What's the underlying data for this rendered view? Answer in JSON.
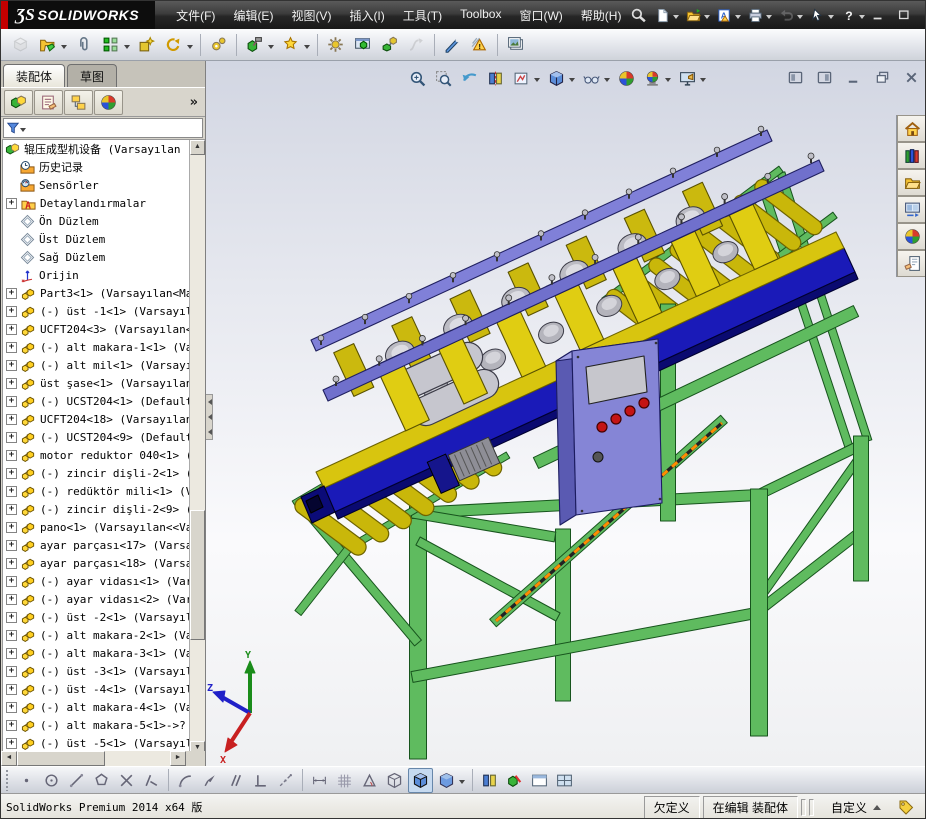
{
  "brand": {
    "mark": "ƷS",
    "name": "SOLIDWORKS"
  },
  "menu": {
    "items": [
      "文件(F)",
      "编辑(E)",
      "视图(V)",
      "插入(I)",
      "工具(T)",
      "Toolbox",
      "窗口(W)",
      "帮助(H)"
    ],
    "names": [
      "file",
      "edit",
      "view",
      "insert",
      "tools",
      "toolbox",
      "window",
      "help"
    ]
  },
  "left_panel": {
    "tabs": [
      {
        "label": "装配体",
        "active": true
      },
      {
        "label": "草图",
        "active": false
      }
    ],
    "overflow": "»"
  },
  "tree": {
    "items": [
      {
        "icon": "t-assembly",
        "plus": false,
        "indent": 0,
        "label": "辊压成型机设备 (Varsayılan"
      },
      {
        "icon": "t-history",
        "plus": false,
        "indent": 1,
        "label": "历史记录"
      },
      {
        "icon": "t-sensors",
        "plus": false,
        "indent": 1,
        "label": "Sensörler"
      },
      {
        "icon": "t-annotations",
        "plus": true,
        "indent": 1,
        "label": "Detaylandırmalar"
      },
      {
        "icon": "t-plane",
        "plus": false,
        "indent": 1,
        "label": "Ön Düzlem"
      },
      {
        "icon": "t-plane",
        "plus": false,
        "indent": 1,
        "label": "Üst Düzlem"
      },
      {
        "icon": "t-plane",
        "plus": false,
        "indent": 1,
        "label": "Sağ Düzlem"
      },
      {
        "icon": "t-origin",
        "plus": false,
        "indent": 1,
        "label": "Orijin"
      },
      {
        "icon": "t-part",
        "plus": true,
        "indent": 1,
        "label": "Part3<1> (Varsayılan<Mak"
      },
      {
        "icon": "t-part",
        "plus": true,
        "indent": 1,
        "label": "(-) üst -1<1> (Varsayıla"
      },
      {
        "icon": "t-part",
        "plus": true,
        "indent": 1,
        "label": "UCFT204<3> (Varsayılan<<"
      },
      {
        "icon": "t-part",
        "plus": true,
        "indent": 1,
        "label": "(-) alt makara-1<1> (Var"
      },
      {
        "icon": "t-part",
        "plus": true,
        "indent": 1,
        "label": "(-) alt mil<1> (Varsayıl"
      },
      {
        "icon": "t-part",
        "plus": true,
        "indent": 1,
        "label": "üst şase<1> (Varsayılan<"
      },
      {
        "icon": "t-part",
        "plus": true,
        "indent": 1,
        "label": "(-) UCST204<1> (Default<"
      },
      {
        "icon": "t-part",
        "plus": true,
        "indent": 1,
        "label": "UCFT204<18> (Varsayılan<"
      },
      {
        "icon": "t-part",
        "plus": true,
        "indent": 1,
        "label": "(-) UCST204<9> (Default<"
      },
      {
        "icon": "t-part",
        "plus": true,
        "indent": 1,
        "label": "motor reduktor 040<1> (V"
      },
      {
        "icon": "t-part",
        "plus": true,
        "indent": 1,
        "label": "(-) zincir dişli-2<1> (V"
      },
      {
        "icon": "t-part",
        "plus": true,
        "indent": 1,
        "label": "(-) redüktör mili<1> (V:"
      },
      {
        "icon": "t-part",
        "plus": true,
        "indent": 1,
        "label": "(-) zincir dişli-2<9> (V"
      },
      {
        "icon": "t-part",
        "plus": true,
        "indent": 1,
        "label": "pano<1> (Varsayılan<<Var"
      },
      {
        "icon": "t-part",
        "plus": true,
        "indent": 1,
        "label": "ayar parçası<17> (Varsay"
      },
      {
        "icon": "t-part",
        "plus": true,
        "indent": 1,
        "label": "ayar parçası<18> (Varsay"
      },
      {
        "icon": "t-part",
        "plus": true,
        "indent": 1,
        "label": "(-) ayar vidası<1> (Vars"
      },
      {
        "icon": "t-part",
        "plus": true,
        "indent": 1,
        "label": "(-) ayar vidası<2> (Vars"
      },
      {
        "icon": "t-part",
        "plus": true,
        "indent": 1,
        "label": "(-) üst -2<1> (Varsayıla"
      },
      {
        "icon": "t-part",
        "plus": true,
        "indent": 1,
        "label": "(-) alt makara-2<1> (Var"
      },
      {
        "icon": "t-part",
        "plus": true,
        "indent": 1,
        "label": "(-) alt makara-3<1> (Var"
      },
      {
        "icon": "t-part",
        "plus": true,
        "indent": 1,
        "label": "(-) üst -3<1> (Varsayıla"
      },
      {
        "icon": "t-part",
        "plus": true,
        "indent": 1,
        "label": "(-) üst -4<1> (Varsayıla"
      },
      {
        "icon": "t-part",
        "plus": true,
        "indent": 1,
        "label": "(-) alt makara-4<1> (Var"
      },
      {
        "icon": "t-part",
        "plus": true,
        "indent": 1,
        "label": "(-) alt makara-5<1>->?"
      },
      {
        "icon": "t-part",
        "plus": true,
        "indent": 1,
        "label": "(-) üst -5<1> (Varsayıla"
      },
      {
        "icon": "t-part",
        "plus": true,
        "indent": 1,
        "label": ""
      }
    ]
  },
  "toolbars": {
    "quick_access": [
      {
        "name": "new-document",
        "dropdown": true
      },
      {
        "name": "open-folder",
        "dropdown": true
      },
      {
        "name": "report",
        "dropdown": true
      },
      {
        "name": "print",
        "dropdown": true
      },
      {
        "name": "undo",
        "dropdown": true,
        "disabled": true
      },
      {
        "name": "select-cursor",
        "dropdown": true
      },
      {
        "name": "help",
        "dropdown": true
      }
    ],
    "assembly": [
      {
        "name": "insert-components",
        "disabled": true
      },
      {
        "name": "edit-component",
        "dropdown": true
      },
      {
        "name": "mate"
      },
      {
        "name": "component-pattern",
        "dropdown": true
      },
      {
        "name": "smart-fasteners"
      },
      {
        "name": "move-component",
        "dropdown": true
      },
      {
        "sep": true
      },
      {
        "name": "gear-tools"
      },
      {
        "sep": true
      },
      {
        "name": "assembly-features",
        "dropdown": true
      },
      {
        "name": "reference-star",
        "dropdown": true
      },
      {
        "sep": true
      },
      {
        "name": "motion-gear"
      },
      {
        "name": "show-window"
      },
      {
        "name": "exploded-view"
      },
      {
        "name": "explode-line-sketch",
        "disabled": true
      },
      {
        "sep": true
      },
      {
        "name": "instant3d"
      },
      {
        "name": "interference-detection"
      },
      {
        "sep": true
      },
      {
        "name": "take-snapshot"
      }
    ],
    "headsup": [
      {
        "name": "zoom-to-fit"
      },
      {
        "name": "zoom-to-area"
      },
      {
        "name": "previous-view"
      },
      {
        "name": "section-view"
      },
      {
        "name": "view-orientation",
        "dropdown": true
      },
      {
        "name": "display-style",
        "dropdown": true
      },
      {
        "name": "hide-show-items",
        "dropdown": true
      },
      {
        "name": "edit-appearance"
      },
      {
        "name": "apply-scene",
        "dropdown": true
      },
      {
        "name": "view-settings",
        "dropdown": true
      }
    ],
    "bottom": [
      {
        "name": "point"
      },
      {
        "name": "circle-tool"
      },
      {
        "name": "line-tool"
      },
      {
        "name": "polygon-tool"
      },
      {
        "name": "trim-tool"
      },
      {
        "name": "chamfer-tool"
      },
      {
        "sep": true
      },
      {
        "name": "tangent-arc"
      },
      {
        "name": "sketch-arrow"
      },
      {
        "name": "parallel"
      },
      {
        "name": "perpendicular"
      },
      {
        "name": "construction-line"
      },
      {
        "sep": true
      },
      {
        "name": "dimension"
      },
      {
        "name": "grid-tool"
      },
      {
        "name": "angle-tool"
      },
      {
        "name": "wireframe"
      },
      {
        "name": "shaded-edges",
        "pressed": true
      },
      {
        "name": "shaded",
        "dropdown": true
      },
      {
        "sep": true
      },
      {
        "name": "section-tool"
      },
      {
        "name": "assembly-transparency"
      },
      {
        "name": "window-pane"
      },
      {
        "name": "window-grid"
      }
    ],
    "manager_tabs": [
      {
        "name": "featuremanager",
        "pressed": true
      },
      {
        "name": "propertymanager"
      },
      {
        "name": "configurationmanager"
      },
      {
        "name": "displaymanager"
      }
    ],
    "task_pane": [
      {
        "name": "home"
      },
      {
        "name": "design-library"
      },
      {
        "name": "file-explorer"
      },
      {
        "name": "view-palette"
      },
      {
        "name": "appearances"
      },
      {
        "name": "custom-properties"
      }
    ],
    "vp_controls": [
      {
        "name": "pane-left"
      },
      {
        "name": "pane-right"
      },
      {
        "name": "win-min"
      },
      {
        "name": "win-restore"
      },
      {
        "name": "win-close"
      }
    ],
    "title_controls": [
      {
        "name": "tb-min"
      },
      {
        "name": "tb-restore"
      },
      {
        "name": "tb-close"
      }
    ]
  },
  "status_bar": {
    "left": "SolidWorks Premium 2014 x64 版",
    "defined_state": "欠定义",
    "editing_state": "在编辑 装配体",
    "custom": "自定义"
  },
  "model": {
    "triad": {
      "x": "X",
      "y": "Y",
      "z": "Z"
    },
    "colors": {
      "frame_green": "#5fbb5f",
      "frame_green_dark": "#17541d",
      "roller_yellow": "#c9b70a",
      "roller_yellow_dark": "#6e6300",
      "deck_yellow": "#d8c50f",
      "beam_blue": "#1a1ab8",
      "rail_purple": "#7070cc",
      "roller_gray": "#bcbcc4",
      "panel_purple": "#8585d6",
      "sketch_orange": "#ff8c00",
      "accent_red": "#c40000"
    }
  }
}
